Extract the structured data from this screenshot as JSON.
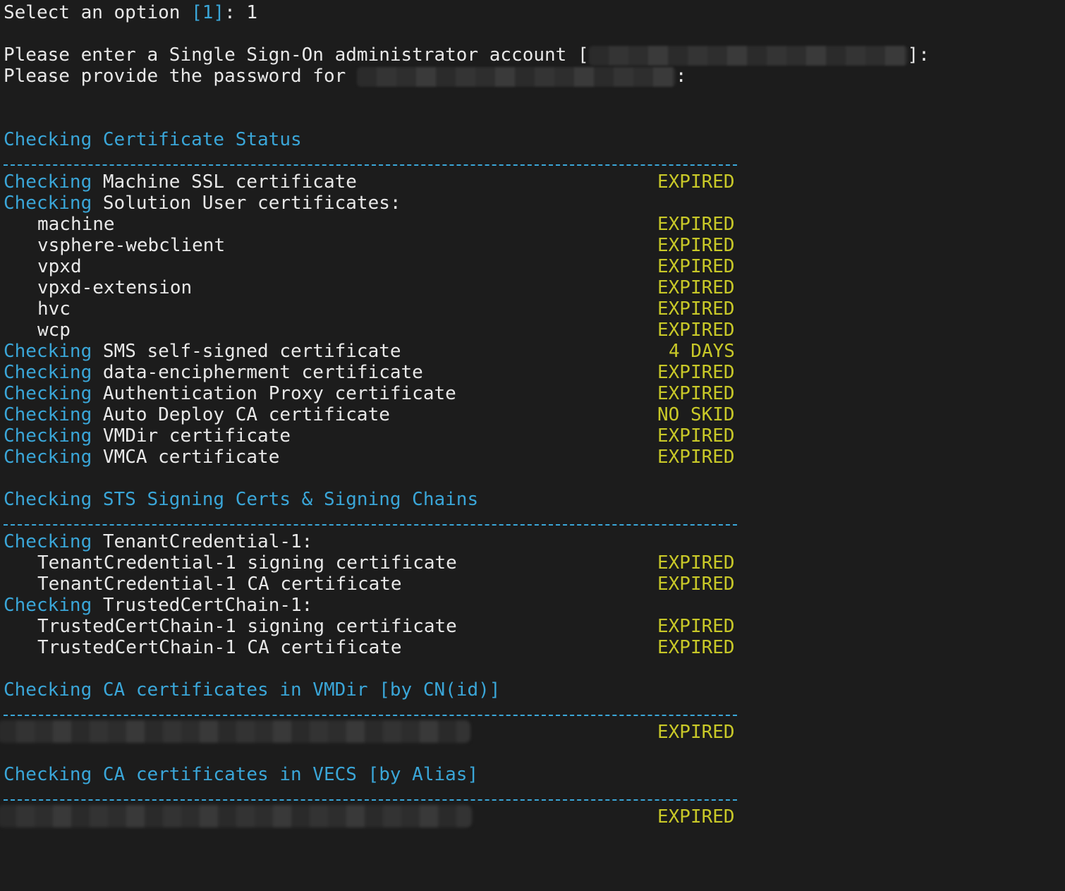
{
  "prompt": {
    "select_label": "Select an option ",
    "select_default": "[1]",
    "select_suffix": ": 1",
    "sso_label": "Please enter a Single Sign-On administrator account [",
    "sso_suffix": "]:",
    "password_label": "Please provide the password for ",
    "password_suffix": ":"
  },
  "sections": {
    "cert_status": {
      "title": "Checking Certificate Status",
      "separator": "------------------------------------------------------------------"
    },
    "sts": {
      "title": "Checking STS Signing Certs & Signing Chains",
      "separator": "------------------------------------------------------------------"
    },
    "vmdir": {
      "title": "Checking CA certificates in VMDir [by CN(id)]",
      "separator": "------------------------------------------------------------------",
      "status": "EXPIRED"
    },
    "vecs": {
      "title": "Checking CA certificates in VECS [by Alias]",
      "separator": "------------------------------------------------------------------",
      "status": "EXPIRED"
    }
  },
  "checking_word": "Checking",
  "cert_rows": [
    {
      "prefix": true,
      "label": " Machine SSL certificate",
      "status": "EXPIRED",
      "indent": false
    },
    {
      "prefix": true,
      "label": " Solution User certificates:",
      "status": "",
      "indent": false
    },
    {
      "prefix": false,
      "label": "machine",
      "status": "EXPIRED",
      "indent": true
    },
    {
      "prefix": false,
      "label": "vsphere-webclient",
      "status": "EXPIRED",
      "indent": true
    },
    {
      "prefix": false,
      "label": "vpxd",
      "status": "EXPIRED",
      "indent": true
    },
    {
      "prefix": false,
      "label": "vpxd-extension",
      "status": "EXPIRED",
      "indent": true
    },
    {
      "prefix": false,
      "label": "hvc",
      "status": "EXPIRED",
      "indent": true
    },
    {
      "prefix": false,
      "label": "wcp",
      "status": "EXPIRED",
      "indent": true
    },
    {
      "prefix": true,
      "label": " SMS self-signed certificate",
      "status": "4 DAYS",
      "indent": false
    },
    {
      "prefix": true,
      "label": " data-encipherment certificate",
      "status": "EXPIRED",
      "indent": false
    },
    {
      "prefix": true,
      "label": " Authentication Proxy certificate",
      "status": "EXPIRED",
      "indent": false
    },
    {
      "prefix": true,
      "label": " Auto Deploy CA certificate",
      "status": "NO SKID",
      "indent": false
    },
    {
      "prefix": true,
      "label": " VMDir certificate",
      "status": "EXPIRED",
      "indent": false
    },
    {
      "prefix": true,
      "label": " VMCA certificate",
      "status": "EXPIRED",
      "indent": false
    }
  ],
  "sts_rows": [
    {
      "prefix": true,
      "label": " TenantCredential-1:",
      "status": "",
      "indent": false
    },
    {
      "prefix": false,
      "label": "TenantCredential-1 signing certificate",
      "status": "EXPIRED",
      "indent": true
    },
    {
      "prefix": false,
      "label": "TenantCredential-1 CA certificate",
      "status": "EXPIRED",
      "indent": true
    },
    {
      "prefix": true,
      "label": " TrustedCertChain-1:",
      "status": "",
      "indent": false
    },
    {
      "prefix": false,
      "label": "TrustedCertChain-1 signing certificate",
      "status": "EXPIRED",
      "indent": true
    },
    {
      "prefix": false,
      "label": "TrustedCertChain-1 CA certificate",
      "status": "EXPIRED",
      "indent": true
    }
  ],
  "colors": {
    "background": "#1c1c1c",
    "text": "#e8e8e8",
    "accent_cyan": "#3aa6d8",
    "status_yellow": "#c8c828"
  }
}
